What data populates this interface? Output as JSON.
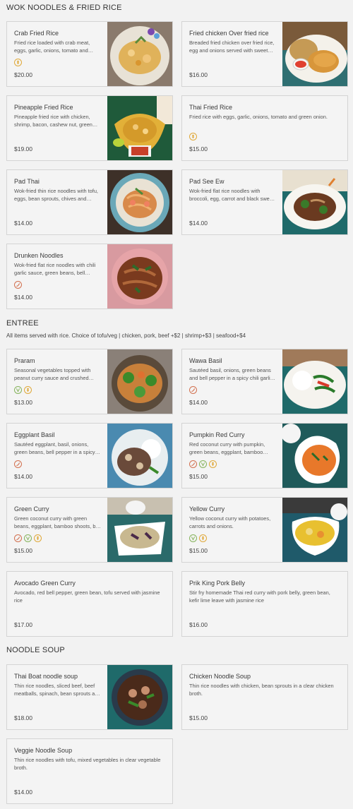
{
  "sections": {
    "wok": {
      "title": "WOK NOODLES & FRIED RICE"
    },
    "entree": {
      "title": "ENTREE",
      "note": "All items served with rice. Choice of tofu/veg | chicken, pork, beef +$2 | shrimp+$3 | seafood+$4"
    },
    "soup": {
      "title": "NOODLE SOUP"
    }
  },
  "items": [
    {
      "name": "Crab Fried Rice",
      "desc": "Fried rice loaded with crab meat, eggs, garlic, onions, tomato and green onion.",
      "price": "$20.00",
      "icons": [
        "gluten-free-icon"
      ]
    },
    {
      "name": "Fried chicken Over fried rice",
      "desc": "Breaded fried chicken over fried rice, egg and onions served with sweet chili sauce.",
      "price": "$16.00",
      "icons": []
    },
    {
      "name": "Pineapple Fried Rice",
      "desc": "Pineapple fried rice with chicken, shrimp, bacon, cashew nut, green onion and raisin.",
      "price": "$19.00",
      "icons": []
    },
    {
      "name": "Thai Fried Rice",
      "desc": "Fried rice with eggs, garlic, onions, tomato and green onion.",
      "price": "$15.00",
      "icons": [
        "gluten-free-icon"
      ]
    },
    {
      "name": "Pad Thai",
      "desc": "Wok-fried thin rice noodles with tofu, eggs, bean sprouts, chives and crushed peanuts.",
      "price": "$14.00",
      "icons": []
    },
    {
      "name": "Pad See Ew",
      "desc": "Wok-fried flat rice noodles with broccoli, egg, carrot and black sweet soy sauce.",
      "price": "$14.00",
      "icons": []
    },
    {
      "name": "Drunken Noodles",
      "desc": "Wok-fried flat rice noodles with chili garlic sauce, green beans, bell pepper and basil.",
      "price": "$14.00",
      "icons": [
        "spicy-icon"
      ]
    },
    {
      "name": "Praram",
      "desc": "Seasonal vegetables topped with peanut curry sauce and crushed peanuts.",
      "price": "$13.00",
      "icons": [
        "vegetarian-icon",
        "gluten-free-icon"
      ]
    },
    {
      "name": "Wawa Basil",
      "desc": "Sautéed basil, onions, green beans and bell pepper in a spicy chili garlic sauce.",
      "price": "$14.00",
      "icons": [
        "spicy-icon"
      ]
    },
    {
      "name": "Eggplant Basil",
      "desc": "Sautéed eggplant, basil, onions, green beans, bell pepper in a spicy chili garlic sauce.",
      "price": "$14.00",
      "icons": [
        "spicy-icon"
      ]
    },
    {
      "name": "Pumpkin Red Curry",
      "desc": "Red coconut curry with pumpkin, green beans, eggplant, bamboo shoots and basil.",
      "price": "$15.00",
      "icons": [
        "spicy-icon",
        "vegetarian-icon",
        "gluten-free-icon"
      ]
    },
    {
      "name": "Green Curry",
      "desc": "Green coconut curry with green beans, eggplant, bamboo shoots, bell pepper and basil.",
      "price": "$15.00",
      "icons": [
        "spicy-icon",
        "vegetarian-icon",
        "gluten-free-icon"
      ]
    },
    {
      "name": "Yellow Curry",
      "desc": "Yellow coconut curry with potatoes, carrots and onions.",
      "price": "$15.00",
      "icons": [
        "vegetarian-icon",
        "gluten-free-icon"
      ]
    },
    {
      "name": "Avocado Green Curry",
      "desc": "Avocado, red bell pepper, green bean, tofu served with jasmine rice",
      "price": "$17.00",
      "icons": []
    },
    {
      "name": "Prik King Pork Belly",
      "desc": "Stir fry homemade Thai red curry with pork belly, green bean, kefir lime leave with jasmine rice",
      "price": "$16.00",
      "icons": []
    },
    {
      "name": "Thai Boat noodle soup",
      "desc": "Thin rice noodles, sliced beef, beef meatballs, spinach, bean sprouts and cilantro.",
      "price": "$18.00",
      "icons": []
    },
    {
      "name": "Chicken Noodle Soup",
      "desc": "Thin rice noodles with chicken, bean sprouts in a clear chicken broth.",
      "price": "$15.00",
      "icons": []
    },
    {
      "name": "Veggie Noodle Soup",
      "desc": "Thin rice noodles with tofu, mixed vegetables in clear vegetable broth.",
      "price": "$14.00",
      "icons": []
    }
  ],
  "colors": {
    "spicy": "#d2704f",
    "vegetarian": "#86b35c",
    "gluten_free": "#e0a93a"
  }
}
